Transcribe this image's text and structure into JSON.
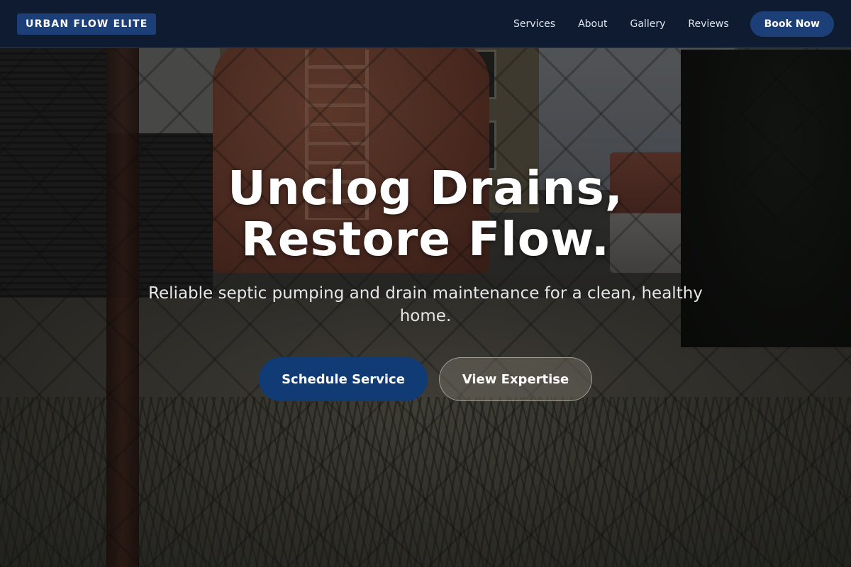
{
  "header": {
    "logo_text": "URBAN FLOW ELITE",
    "nav": [
      {
        "label": "Services"
      },
      {
        "label": "About"
      },
      {
        "label": "Gallery"
      },
      {
        "label": "Reviews"
      }
    ],
    "book_label": "Book Now"
  },
  "hero": {
    "headline_line1": "Unclog Drains,",
    "headline_line2": "Restore Flow.",
    "subhead": "Reliable septic pumping and drain maintenance for a clean, healthy home.",
    "primary_cta": "Schedule Service",
    "secondary_cta": "View Expertise"
  },
  "colors": {
    "header_bg": "#0f1b30",
    "brand_blue": "#1c3f77",
    "primary_cta": "#113b74",
    "text_white": "#ffffff"
  }
}
